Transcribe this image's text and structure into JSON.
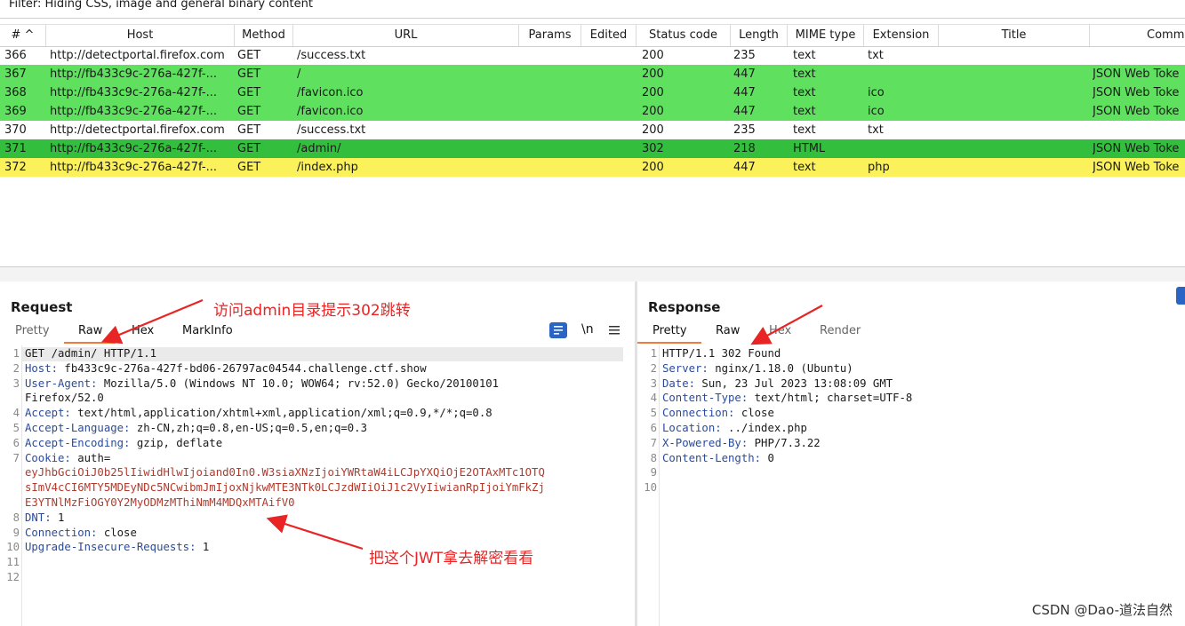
{
  "filter": {
    "text": "Filter: Hiding CSS, image and general binary content"
  },
  "table": {
    "headers": [
      "# ^",
      "Host",
      "Method",
      "URL",
      "Params",
      "Edited",
      "Status code",
      "Length",
      "MIME type",
      "Extension",
      "Title",
      "Comm"
    ],
    "rows": [
      {
        "num": "366",
        "host": "http://detectportal.firefox.com",
        "method": "GET",
        "url": "/success.txt",
        "status": "200",
        "length": "235",
        "mime": "text",
        "ext": "txt",
        "comment": "",
        "style": "white"
      },
      {
        "num": "367",
        "host": "http://fb433c9c-276a-427f-...",
        "method": "GET",
        "url": "/",
        "status": "200",
        "length": "447",
        "mime": "text",
        "ext": "",
        "comment": "JSON Web Toke",
        "style": "g1"
      },
      {
        "num": "368",
        "host": "http://fb433c9c-276a-427f-...",
        "method": "GET",
        "url": "/favicon.ico",
        "status": "200",
        "length": "447",
        "mime": "text",
        "ext": "ico",
        "comment": "JSON Web Toke",
        "style": "g1"
      },
      {
        "num": "369",
        "host": "http://fb433c9c-276a-427f-...",
        "method": "GET",
        "url": "/favicon.ico",
        "status": "200",
        "length": "447",
        "mime": "text",
        "ext": "ico",
        "comment": "JSON Web Toke",
        "style": "g1"
      },
      {
        "num": "370",
        "host": "http://detectportal.firefox.com",
        "method": "GET",
        "url": "/success.txt",
        "status": "200",
        "length": "235",
        "mime": "text",
        "ext": "txt",
        "comment": "",
        "style": "white"
      },
      {
        "num": "371",
        "host": "http://fb433c9c-276a-427f-...",
        "method": "GET",
        "url": "/admin/",
        "status": "302",
        "length": "218",
        "mime": "HTML",
        "ext": "",
        "comment": "JSON Web Toke",
        "style": "g2"
      },
      {
        "num": "372",
        "host": "http://fb433c9c-276a-427f-...",
        "method": "GET",
        "url": "/index.php",
        "status": "200",
        "length": "447",
        "mime": "text",
        "ext": "php",
        "comment": "JSON Web Toke",
        "style": "yl"
      }
    ]
  },
  "request": {
    "title": "Request",
    "tabs": [
      "Pretty",
      "Raw",
      "Hex",
      "MarkInfo"
    ],
    "active_tab": "Raw",
    "toolbar": {
      "newline_label": "\\n"
    },
    "lines": [
      {
        "n": "1",
        "key": "",
        "val": "GET /admin/ HTTP/1.1"
      },
      {
        "n": "2",
        "key": "Host:",
        "val": " fb433c9c-276a-427f-bd06-26797ac04544.challenge.ctf.show"
      },
      {
        "n": "3",
        "key": "User-Agent:",
        "val": " Mozilla/5.0 (Windows NT 10.0; WOW64; rv:52.0) Gecko/20100101"
      },
      {
        "n": "",
        "key": "",
        "val": "Firefox/52.0"
      },
      {
        "n": "4",
        "key": "Accept:",
        "val": " text/html,application/xhtml+xml,application/xml;q=0.9,*/*;q=0.8"
      },
      {
        "n": "5",
        "key": "Accept-Language:",
        "val": " zh-CN,zh;q=0.8,en-US;q=0.5,en;q=0.3"
      },
      {
        "n": "6",
        "key": "Accept-Encoding:",
        "val": " gzip, deflate"
      },
      {
        "n": "7",
        "key": "Cookie:",
        "val": " auth="
      },
      {
        "n": "",
        "key": "",
        "val": "eyJhbGciOiJ0b25lIiwidHlwIjoiand0In0.W3siaXNzIjoiYWRtaW4iLCJpYXQiOjE2OTAxMTc1OTQ",
        "red": true
      },
      {
        "n": "",
        "key": "",
        "val": "sImV4cCI6MTY5MDEyNDc5NCwibmJmIjoxNjkwMTE3NTk0LCJzdWIiOiJ1c2VyIiwianRpIjoiYmFkZj",
        "red": true
      },
      {
        "n": "",
        "key": "",
        "val": "E3YTNlMzFiOGY0Y2MyODMzMThiNmM4MDQxMTAifV0",
        "red": true
      },
      {
        "n": "8",
        "key": "DNT:",
        "val": " 1"
      },
      {
        "n": "9",
        "key": "Connection:",
        "val": " close"
      },
      {
        "n": "10",
        "key": "Upgrade-Insecure-Requests:",
        "val": " 1"
      },
      {
        "n": "11",
        "key": "",
        "val": ""
      },
      {
        "n": "12",
        "key": "",
        "val": ""
      }
    ]
  },
  "response": {
    "title": "Response",
    "tabs": [
      "Pretty",
      "Raw",
      "Hex",
      "Render"
    ],
    "active_tab": "Pretty",
    "lines": [
      {
        "n": "1",
        "key": "",
        "val": "HTTP/1.1 302 Found"
      },
      {
        "n": "2",
        "key": "Server:",
        "val": " nginx/1.18.0 (Ubuntu)"
      },
      {
        "n": "3",
        "key": "Date:",
        "val": " Sun, 23 Jul 2023 13:08:09 GMT"
      },
      {
        "n": "4",
        "key": "Content-Type:",
        "val": " text/html; charset=UTF-8"
      },
      {
        "n": "5",
        "key": "Connection:",
        "val": " close"
      },
      {
        "n": "6",
        "key": "Location:",
        "val": " ../index.php"
      },
      {
        "n": "7",
        "key": "X-Powered-By:",
        "val": " PHP/7.3.22"
      },
      {
        "n": "8",
        "key": "Content-Length:",
        "val": " 0"
      },
      {
        "n": "9",
        "key": "",
        "val": ""
      },
      {
        "n": "10",
        "key": "",
        "val": ""
      }
    ]
  },
  "annotations": {
    "admin_note": "访问admin目录提示302跳转",
    "jwt_note": "把这个JWT拿去解密看看"
  },
  "watermark": "CSDN @Dao-道法自然",
  "colors": {
    "accent": "#f07b3f",
    "green": "#5fe05f",
    "dark_green": "#33bf3d",
    "yellow": "#fbf25b",
    "annotation": "#e82424",
    "header_key": "#2a4b9c",
    "jwt": "#b23a2c"
  }
}
